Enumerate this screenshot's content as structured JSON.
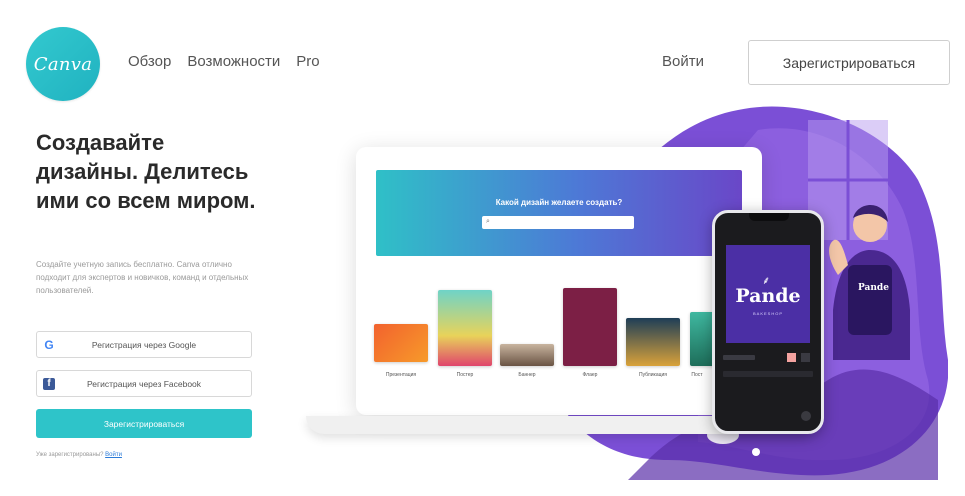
{
  "header": {
    "logo_text": "Canva",
    "nav": [
      "Обзор",
      "Возможности",
      "Pro"
    ],
    "login_label": "Войти",
    "signup_label": "Зарегистрироваться"
  },
  "hero": {
    "headline": "Создавайте дизайны. Делитесь ими со всем миром.",
    "description": "Создайте учетную запись бесплатно. Canva отлично подходит для экспертов и новичков, команд и отдельных пользователей.",
    "google_label": "Регистрация через Google",
    "facebook_label": "Регистрация через Facebook",
    "primary_label": "Зарегистрироваться",
    "already_text": "Уже зарегистрированы?",
    "login_link": "Войти"
  },
  "laptop": {
    "question": "Какой дизайн желаете создать?",
    "thumbnails": [
      {
        "label": "Презентация",
        "color": "#f2622e"
      },
      {
        "label": "Постер",
        "color": "#e6eef0"
      },
      {
        "label": "Баннер",
        "color": "#8a6a55"
      },
      {
        "label": "Флаер",
        "color": "#7c1f45"
      },
      {
        "label": "Публикация",
        "color": "#1e3e57"
      },
      {
        "label": "Пост",
        "color": "#2a8c6d"
      }
    ]
  },
  "phone": {
    "brand": "Pande",
    "tagline": "BAKESHOP"
  },
  "illustration": {
    "mascot_text": "Pande"
  },
  "colors": {
    "brand": "#2ec4c9",
    "purple": "#6a3fc8"
  }
}
